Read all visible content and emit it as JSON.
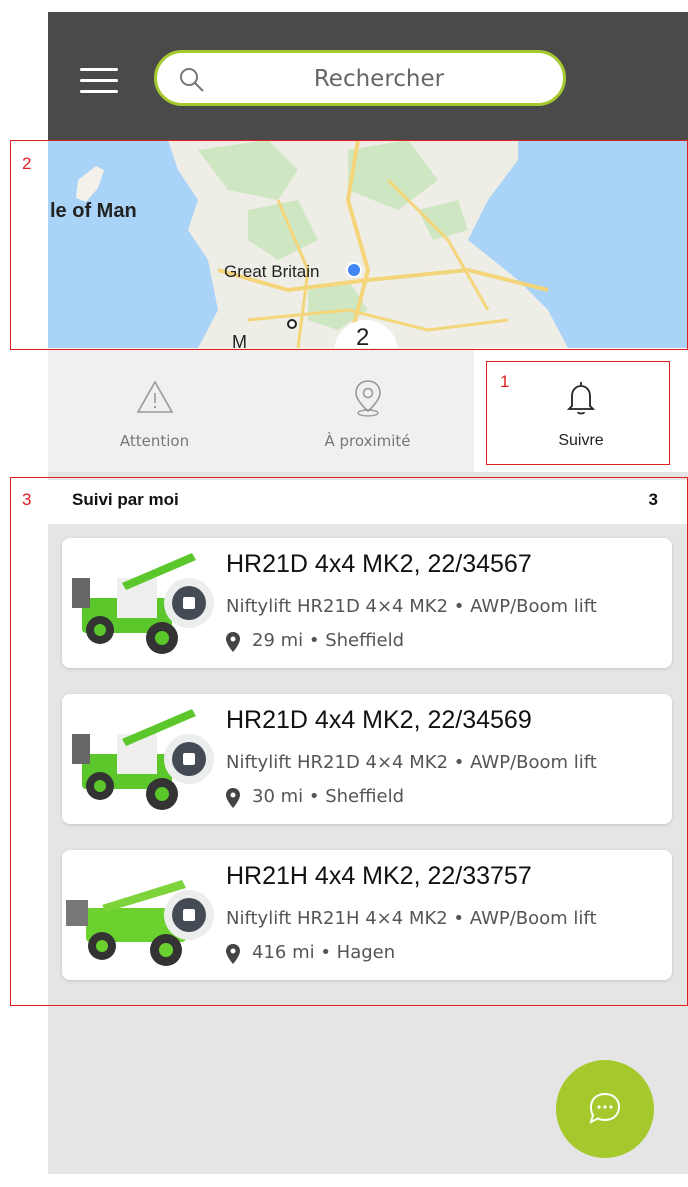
{
  "search": {
    "placeholder": "Rechercher"
  },
  "map": {
    "labels": [
      "le of Man",
      "Great Britain",
      "M",
      "2"
    ]
  },
  "tabs": [
    {
      "label": "Attention",
      "icon": "warning-icon"
    },
    {
      "label": "À proximité",
      "icon": "location-pin-icon"
    },
    {
      "label": "Suivre",
      "icon": "bell-icon",
      "active": true
    }
  ],
  "section": {
    "title": "Suivi par moi",
    "count": "3"
  },
  "items": [
    {
      "title": "HR21D 4x4 MK2, 22/34567",
      "subtitle": "Niftylift HR21D 4×4 MK2 • AWP/Boom lift",
      "location": "29 mi • Sheffield"
    },
    {
      "title": "HR21D 4x4 MK2, 22/34569",
      "subtitle": "Niftylift HR21D 4×4 MK2 • AWP/Boom lift",
      "location": "30 mi • Sheffield"
    },
    {
      "title": "HR21H 4x4 MK2, 22/33757",
      "subtitle": "Niftylift HR21H 4×4 MK2 • AWP/Boom lift",
      "location": "416 mi • Hagen"
    }
  ],
  "annotations": [
    "1",
    "2",
    "3"
  ],
  "colors": {
    "accent": "#a5c92c",
    "header": "#4a4a4a",
    "annotation": "#e02020"
  }
}
